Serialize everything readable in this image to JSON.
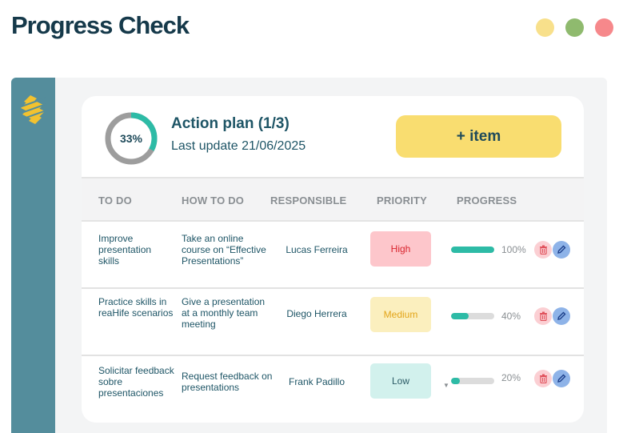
{
  "header": {
    "title": "Progress Check"
  },
  "window_controls": [
    "yellow",
    "green",
    "red"
  ],
  "colors": {
    "accent": "#2dbba6",
    "sidebar": "#548d9c",
    "button": "#f9dd70",
    "high": "#d9262f",
    "medium": "#e3a51a"
  },
  "plan": {
    "percent_label": "33%",
    "progress_fraction": 0.33,
    "title": "Action plan (1/3)",
    "updated": "Last update 21/06/2025"
  },
  "add_button": {
    "label": "+ item"
  },
  "table": {
    "headers": [
      "TO DO",
      "HOW TO DO",
      "RESPONSIBLE",
      "PRIORITY",
      "PROGRESS"
    ],
    "rows": [
      {
        "todo": "Improve presentation skills",
        "how": "Take an online course on “Effective Presentations”",
        "responsible": "Lucas Ferreira",
        "priority": "High",
        "progress": 1.0,
        "progress_label": "100%"
      },
      {
        "todo": "Practice skills in reaHife scenarios",
        "how": "Give a presentation at a monthly team meeting",
        "responsible": "Diego Herrera",
        "priority": "Medium",
        "progress": 0.4,
        "progress_label": "40%"
      },
      {
        "todo": "Solicitar feedback sobre presentaciones",
        "how": "Request feedback on presentations",
        "responsible": "Frank Padillo",
        "priority": "Low",
        "progress": 0.2,
        "progress_label": "20%"
      }
    ]
  },
  "icons": {
    "delete": "trash-icon",
    "edit": "pencil-icon",
    "logo": "stripes-logo-icon"
  }
}
